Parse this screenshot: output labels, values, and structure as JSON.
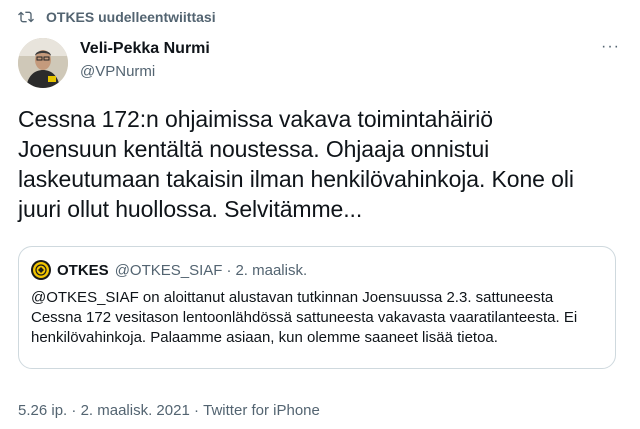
{
  "retweet": {
    "label": "OTKES uudelleentwiittasi",
    "icon": "retweet-icon"
  },
  "author": {
    "name": "Veli-Pekka Nurmi",
    "handle": "@VPNurmi",
    "more_label": "···"
  },
  "tweet": {
    "text": "Cessna 172:n ohjaimissa vakava toimintahäiriö\nJoensuun kentältä noustessa. Ohjaaja onnistui\nlaskeutumaan takaisin ilman henkilövahinkoja. Kone oli\njuuri ollut huollossa. Selvitämme..."
  },
  "quote": {
    "name": "OTKES",
    "handle": "@OTKES_SIAF",
    "separator": "·",
    "date": "2. maalisk.",
    "text": "@OTKES_SIAF on aloittanut alustavan tutkinnan Joensuussa 2.3. sattuneesta\nCessna 172 vesitason lentoonlähdössä sattuneesta vakavasta vaaratilanteesta. Ei\nhenkilövahinkoja. Palaamme asiaan, kun olemme saaneet lisää tietoa."
  },
  "meta": {
    "time": "5.26 ip.",
    "sep1": " · ",
    "date": "2. maalisk. 2021",
    "sep2": " · ",
    "source": "Twitter for iPhone"
  },
  "colors": {
    "text": "#0f1419",
    "secondary": "#536471",
    "border": "#cfd9de",
    "logo_yellow": "#f2c500"
  }
}
